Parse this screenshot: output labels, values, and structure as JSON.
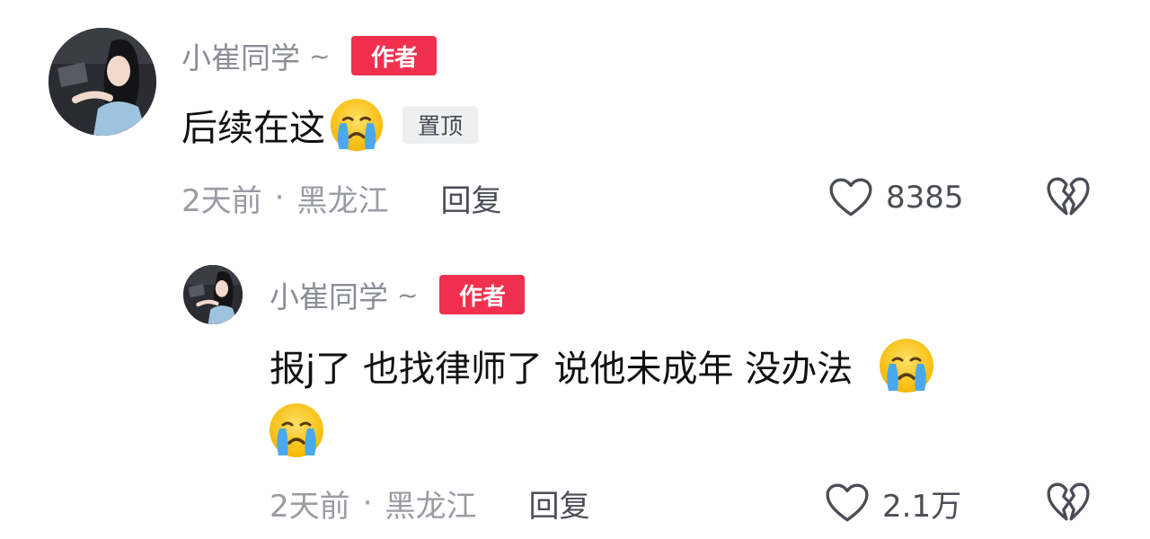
{
  "comments": [
    {
      "username": "小崔同学",
      "expand": "~",
      "author_badge": "作者",
      "text": "后续在这",
      "pinned_badge": "置顶",
      "time": "2天前",
      "separator": "·",
      "location": "黑龙江",
      "reply_label": "回复",
      "likes": "8385",
      "emoji": "crying-face"
    },
    {
      "username": "小崔同学",
      "expand": "~",
      "author_badge": "作者",
      "text": "报j了 也找律师了 说他未成年 没办法",
      "time": "2天前",
      "separator": "·",
      "location": "黑龙江",
      "reply_label": "回复",
      "likes": "2.1万",
      "emoji": "crying-face"
    }
  ],
  "colors": {
    "author_badge": "#f0304e",
    "username": "#8a8d95",
    "meta": "#9a9ca3",
    "text": "#111111"
  }
}
